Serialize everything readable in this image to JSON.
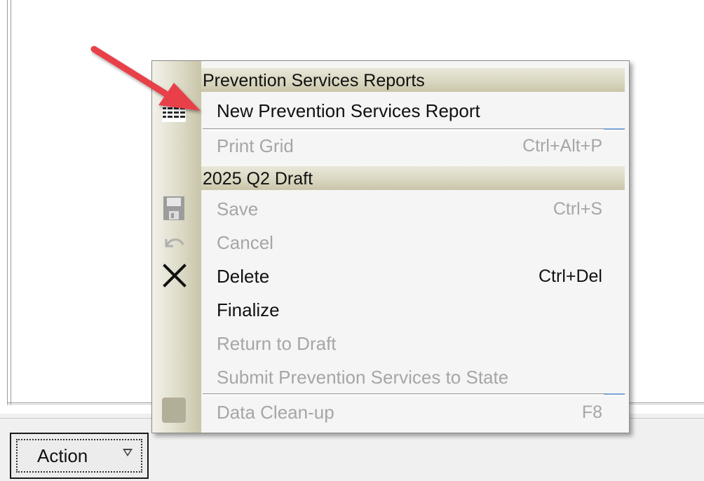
{
  "action_button": {
    "label": "Action"
  },
  "menu": {
    "section1_header": "Prevention Services Reports",
    "new_report": "New Prevention Services Report",
    "print_grid": {
      "label": "Print Grid",
      "shortcut": "Ctrl+Alt+P",
      "enabled": false
    },
    "section2_header": "2025 Q2 Draft",
    "save": {
      "label": "Save",
      "shortcut": "Ctrl+S",
      "enabled": false
    },
    "cancel": {
      "label": "Cancel",
      "enabled": false
    },
    "delete": {
      "label": "Delete",
      "shortcut": "Ctrl+Del",
      "enabled": true
    },
    "finalize": {
      "label": "Finalize",
      "enabled": true
    },
    "return_to_draft": {
      "label": "Return to Draft",
      "enabled": false
    },
    "submit_to_state": {
      "label": "Submit Prevention Services to State",
      "enabled": false
    },
    "data_cleanup": {
      "label": "Data Clean-up",
      "shortcut": "F8",
      "enabled": false
    }
  },
  "colors": {
    "annotation_arrow": "#e8404a",
    "disabled_text": "#a6a6a6"
  }
}
